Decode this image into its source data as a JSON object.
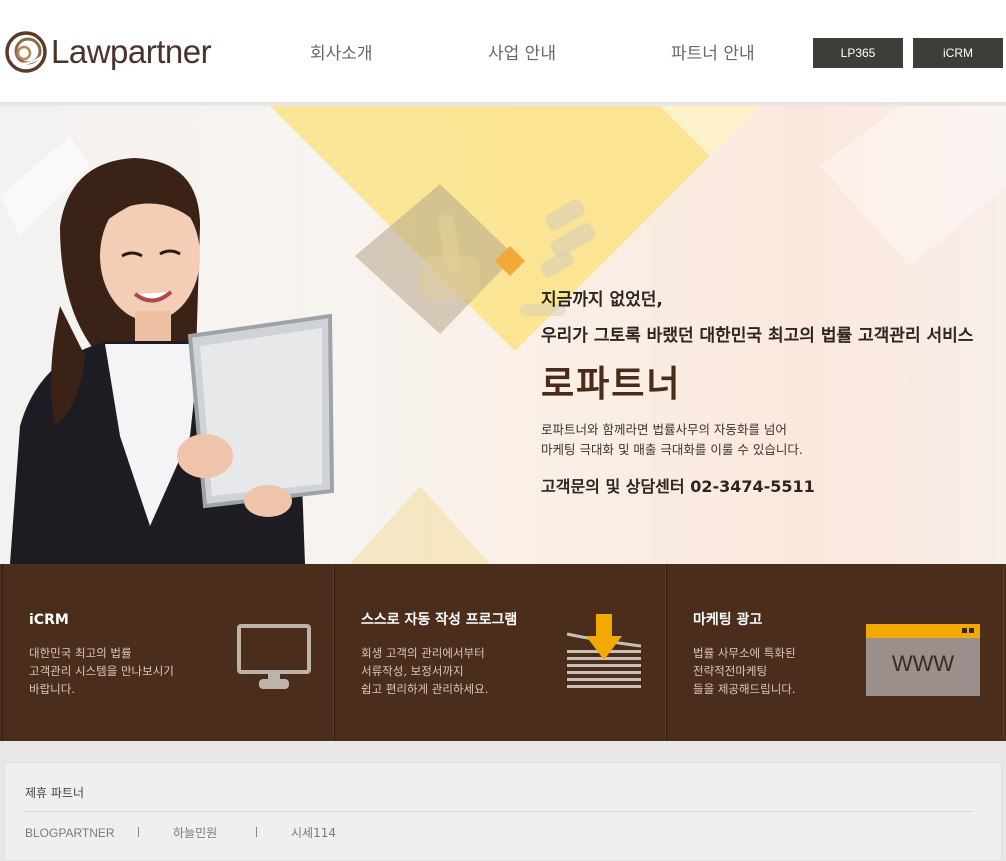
{
  "header": {
    "logo_text": "Lawpartner",
    "nav": [
      "회사소개",
      "사업 안내",
      "파트너 안내"
    ],
    "buttons": [
      "LP365",
      "iCRM"
    ]
  },
  "hero": {
    "line1": "지금까지 없었던,",
    "line2": "우리가 그토록 바랬던 대한민국 최고의 법률 고객관리 서비스",
    "brand": "로파트너",
    "desc1": "로파트너와 함께라면 법률사무의 자동화를 넘어",
    "desc2": "마케팅 극대화 및 매출 극대화를 이룰 수 있습니다.",
    "contact": "고객문의 및 상담센터 02-3474-5511"
  },
  "features": [
    {
      "title": "iCRM",
      "desc": [
        "대한민국 최고의 법률",
        "고객관리 시스템을 만나보시기",
        "바랍니다."
      ],
      "icon": "monitor-icon"
    },
    {
      "title": "스스로 자동 작성 프로그램",
      "desc": [
        "회생 고객의 관리에서부터",
        "서류작성, 보정서까지",
        "쉽고 편리하게 관리하세요."
      ],
      "icon": "document-download-icon"
    },
    {
      "title": "마케팅 광고",
      "desc": [
        "법률 사무소에 특화된",
        "전략적전마케팅",
        "들을 제공해드립니다."
      ],
      "icon": "www-browser-icon",
      "icon_text": "WWW"
    }
  ],
  "partners": {
    "title": "제휴 파트너",
    "links": [
      "BLOGPARTNER",
      "하늘민원",
      "시세114"
    ]
  },
  "colors": {
    "brand_brown": "#4a2d1b",
    "button_dark": "#3f3d37",
    "accent_yellow": "#f4b400"
  }
}
